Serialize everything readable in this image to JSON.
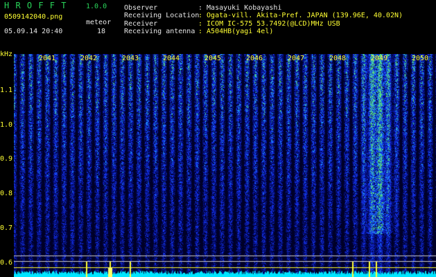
{
  "header": {
    "app_name": "H R O F F T",
    "version": "1.0.0",
    "filename": "0509142040.png",
    "datetime": "05.09.14 20:40",
    "counter_label": "meteor",
    "counter_value": "18"
  },
  "info": [
    {
      "label": "Observer",
      "value": ": Masayuki Kobayashi"
    },
    {
      "label": "Receiving Location",
      "value": ": Ogata-vill. Akita-Pref. JAPAN (139.96E, 40.02N)"
    },
    {
      "label": "Receiver",
      "value": ": ICOM IC-575 53.7492(@LCD)MHz USB"
    },
    {
      "label": "Receiving antenna",
      "value": ": A504HB(yagi 4el)"
    }
  ],
  "axis": {
    "y_unit": "kHz",
    "y_ticks": [
      "1.1",
      "1.0",
      "0.9",
      "0.8",
      "0.7",
      "0.6"
    ],
    "x_ticks": [
      "2041",
      "2042",
      "2043",
      "2044",
      "2045",
      "2046",
      "2047",
      "2048",
      "2049",
      "2050"
    ]
  },
  "colors": {
    "background": "#000000",
    "label_green": "#29d65a",
    "label_white": "#e6e6e6",
    "axis_yellow": "#ffff33",
    "spectrum_dark": "#00105a",
    "spectrum_blue": "#1e3cff",
    "signal_cyan": "#00e5ff"
  }
}
